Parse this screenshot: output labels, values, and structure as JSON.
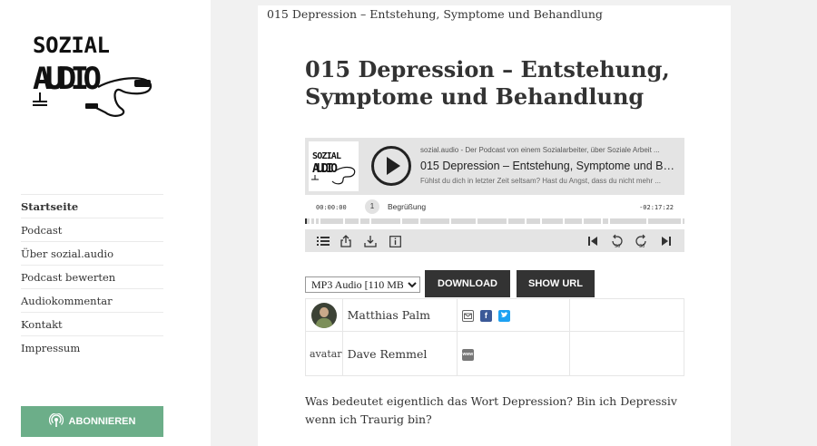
{
  "sidebar": {
    "logo_text_line1": "SOZIAL",
    "logo_text_line2": "AUDIO",
    "nav": [
      {
        "label": "Startseite",
        "active": true
      },
      {
        "label": "Podcast"
      },
      {
        "label": "Über sozial.audio"
      },
      {
        "label": "Podcast bewerten"
      },
      {
        "label": "Audiokommentar"
      },
      {
        "label": "Kontakt"
      },
      {
        "label": "Impressum"
      }
    ],
    "subscribe_label": "ABONNIEREN",
    "subscribe_color": "#6cae89"
  },
  "article": {
    "breadcrumb": "015 Depression – Entstehung, Symptome und Behandlung",
    "title": "015 Depression – Entstehung, Symptome und Behandlung",
    "intro": "Was bedeutet eigentlich das Wort Depression? Bin ich Depressiv wenn ich Traurig bin?"
  },
  "player": {
    "cover_line1": "SOZIAL",
    "cover_line2": "AUDIO",
    "show": "sozial.audio - Der Podcast von einem Sozialarbeiter, über Soziale Arbeit ...",
    "episode_title": "015 Depression – Entstehung, Symptome und Behandlung",
    "description": "Fühlst du dich in letzter Zeit seltsam? Hast du Angst, dass du nicht mehr ...",
    "time_elapsed": "00:00:00",
    "time_remaining": "-02:17:22",
    "chapter_number": "1",
    "chapter_title": "Begrüßung",
    "progress_fraction": 0.005,
    "chapter_markers": [
      0.012,
      0.024,
      0.036,
      0.1,
      0.14,
      0.17,
      0.25,
      0.3,
      0.38,
      0.45,
      0.53,
      0.58,
      0.62,
      0.68,
      0.73,
      0.78,
      0.8,
      0.9,
      0.99
    ]
  },
  "download": {
    "selected_option": "MP3 Audio [110 MB]",
    "download_label": "DOWNLOAD",
    "show_url_label": "SHOW URL"
  },
  "contributors": [
    {
      "name": "Matthias Palm",
      "links": [
        "email-icon",
        "facebook-icon",
        "twitter-icon"
      ]
    },
    {
      "name": "Dave Remmel",
      "avatar_alt": "avatar",
      "links": [
        "website-icon"
      ]
    }
  ],
  "colors": {
    "facebook": "#3b5998",
    "twitter": "#1da1f2",
    "dark_button": "#333333",
    "player_bg": "#e4e4e4"
  }
}
